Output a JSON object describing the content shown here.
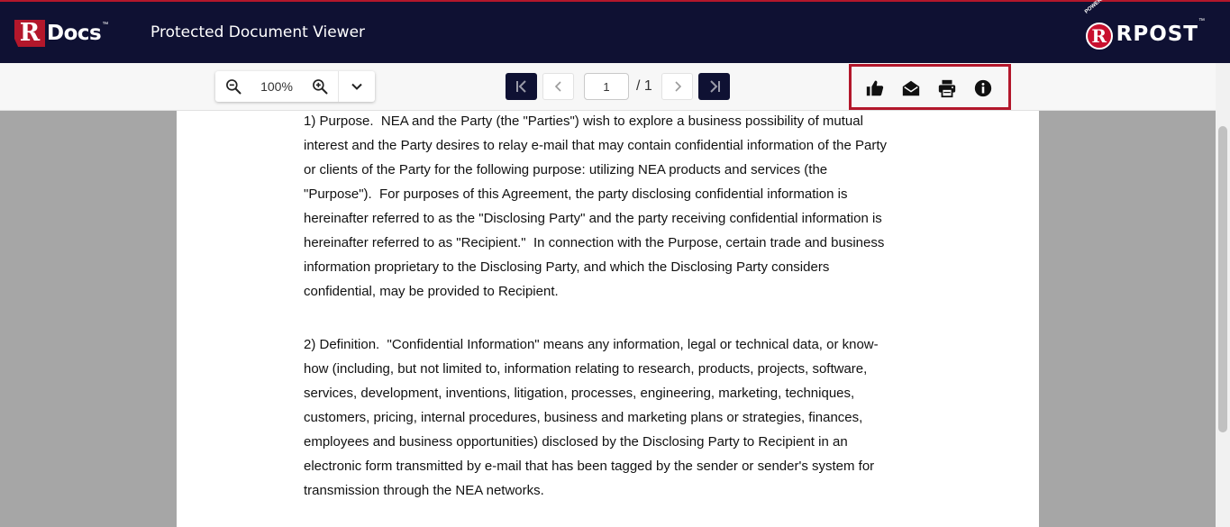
{
  "header": {
    "logo_letter": "R",
    "logo_text": "Docs",
    "logo_tm": "™",
    "title": "Protected Document Viewer",
    "powered_by": "POWERED BY",
    "brand_letter": "R",
    "brand_text": "RPOST",
    "brand_tm": "™",
    "background_color": "#0f1133",
    "accent_color": "#b3172b"
  },
  "toolbar": {
    "zoom_out_icon": "zoom-out-icon",
    "zoom_value": "100%",
    "zoom_in_icon": "zoom-in-icon",
    "zoom_menu_icon": "chevron-down-icon",
    "page_current": "1",
    "page_total": "/ 1",
    "actions": [
      {
        "name": "like",
        "icon": "thumbs-up-icon"
      },
      {
        "name": "reply-email",
        "icon": "envelope-open-icon"
      },
      {
        "name": "print",
        "icon": "printer-icon"
      },
      {
        "name": "info",
        "icon": "info-icon"
      }
    ]
  },
  "document": {
    "paragraphs": [
      {
        "lines": [
          "1) Purpose.  NEA and the Party (the \"Parties\") wish to explore a business possibility of mutual",
          "interest and the Party desires to relay e-mail that may contain confidential information of the Party",
          "or clients of the Party for the following purpose: utilizing NEA products and services (the",
          "\"Purpose\").  For purposes of this Agreement, the party disclosing confidential information is",
          "hereinafter referred to as the \"Disclosing Party\" and the party receiving confidential information is",
          "hereinafter referred to as \"Recipient.\"  In connection with the Purpose, certain trade and business",
          "information proprietary to the Disclosing Party, and which the Disclosing Party considers",
          "confidential, may be provided to Recipient."
        ]
      },
      {
        "lines": [
          "2) Definition.  \"Confidential Information\" means any information, legal or technical data, or know-",
          "how (including, but not limited to, information relating to research, products, projects, software,",
          "services, development, inventions, litigation, processes, engineering, marketing, techniques,",
          "customers, pricing, internal procedures, business and marketing plans or strategies, finances,",
          "employees and business opportunities) disclosed by the Disclosing Party to Recipient in an",
          "electronic form transmitted by e-mail that has been tagged by the sender or sender's system for",
          "transmission through the NEA networks."
        ]
      }
    ]
  }
}
